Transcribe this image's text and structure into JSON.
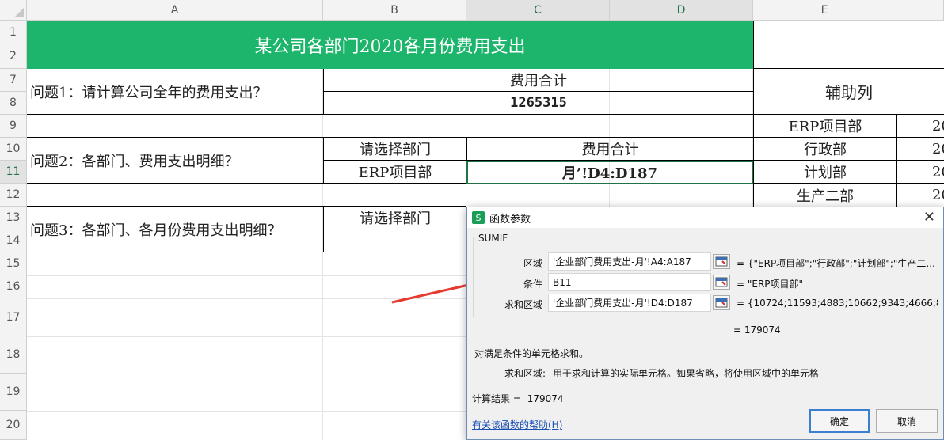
{
  "columns": [
    "A",
    "B",
    "C",
    "D",
    "E"
  ],
  "rows": [
    "1",
    "2",
    "7",
    "8",
    "9",
    "10",
    "11",
    "12",
    "13",
    "14",
    "15",
    "16",
    "17",
    "18",
    "19",
    "20"
  ],
  "cells": {
    "title": "某公司各部门2020各月份费用支出",
    "q1": "问题1：请计算公司全年的费用支出？",
    "q1_header": "费用合计",
    "q1_value": "1265315",
    "aux_header": "辅助列",
    "q2": "问题2：各部门、费用支出明细？",
    "q2_select_label": "请选择部门",
    "q2_total_label": "费用合计",
    "q2_dept": "ERP项目部",
    "q2_formula": "月’!D4:D187",
    "q3": "问题3：各部门、各月份费用支出明细？",
    "q3_select_label": "请选择部门",
    "e9": "ERP项目部",
    "e10": "行政部",
    "e11": "计划部",
    "e12": "生产二部",
    "f9": "20",
    "f10": "20",
    "f11": "20",
    "f12": "20"
  },
  "dialog": {
    "title": "函数参数",
    "icon_label": "S",
    "function_name": "SUMIF",
    "args": [
      {
        "label": "区域",
        "value": "'企业部门费用支出-月'!A4:A187",
        "result": "= {\"ERP项目部\";\"行政部\";\"计划部\";\"生产二..."
      },
      {
        "label": "条件",
        "value": "B11",
        "result": "= \"ERP项目部\""
      },
      {
        "label": "求和区域",
        "value": "'企业部门费用支出-月'!D4:D187",
        "result": "= {10724;11593;4883;10662;9343;4666;8..."
      }
    ],
    "formula_result": "= 179074",
    "description": "对满足条件的单元格求和。",
    "arg_help_label": "求和区域:",
    "arg_help_text": "用于求和计算的实际单元格。如果省略，将使用区域中的单元格",
    "calc_result_label": "计算结果 =",
    "calc_result_value": "179074",
    "help_link": "有关该函数的帮助(H)",
    "ok_label": "确定",
    "cancel_label": "取消"
  },
  "colors": {
    "title_fill": "#1db56b",
    "arrow": "#e8392f",
    "accent": "#217346"
  }
}
